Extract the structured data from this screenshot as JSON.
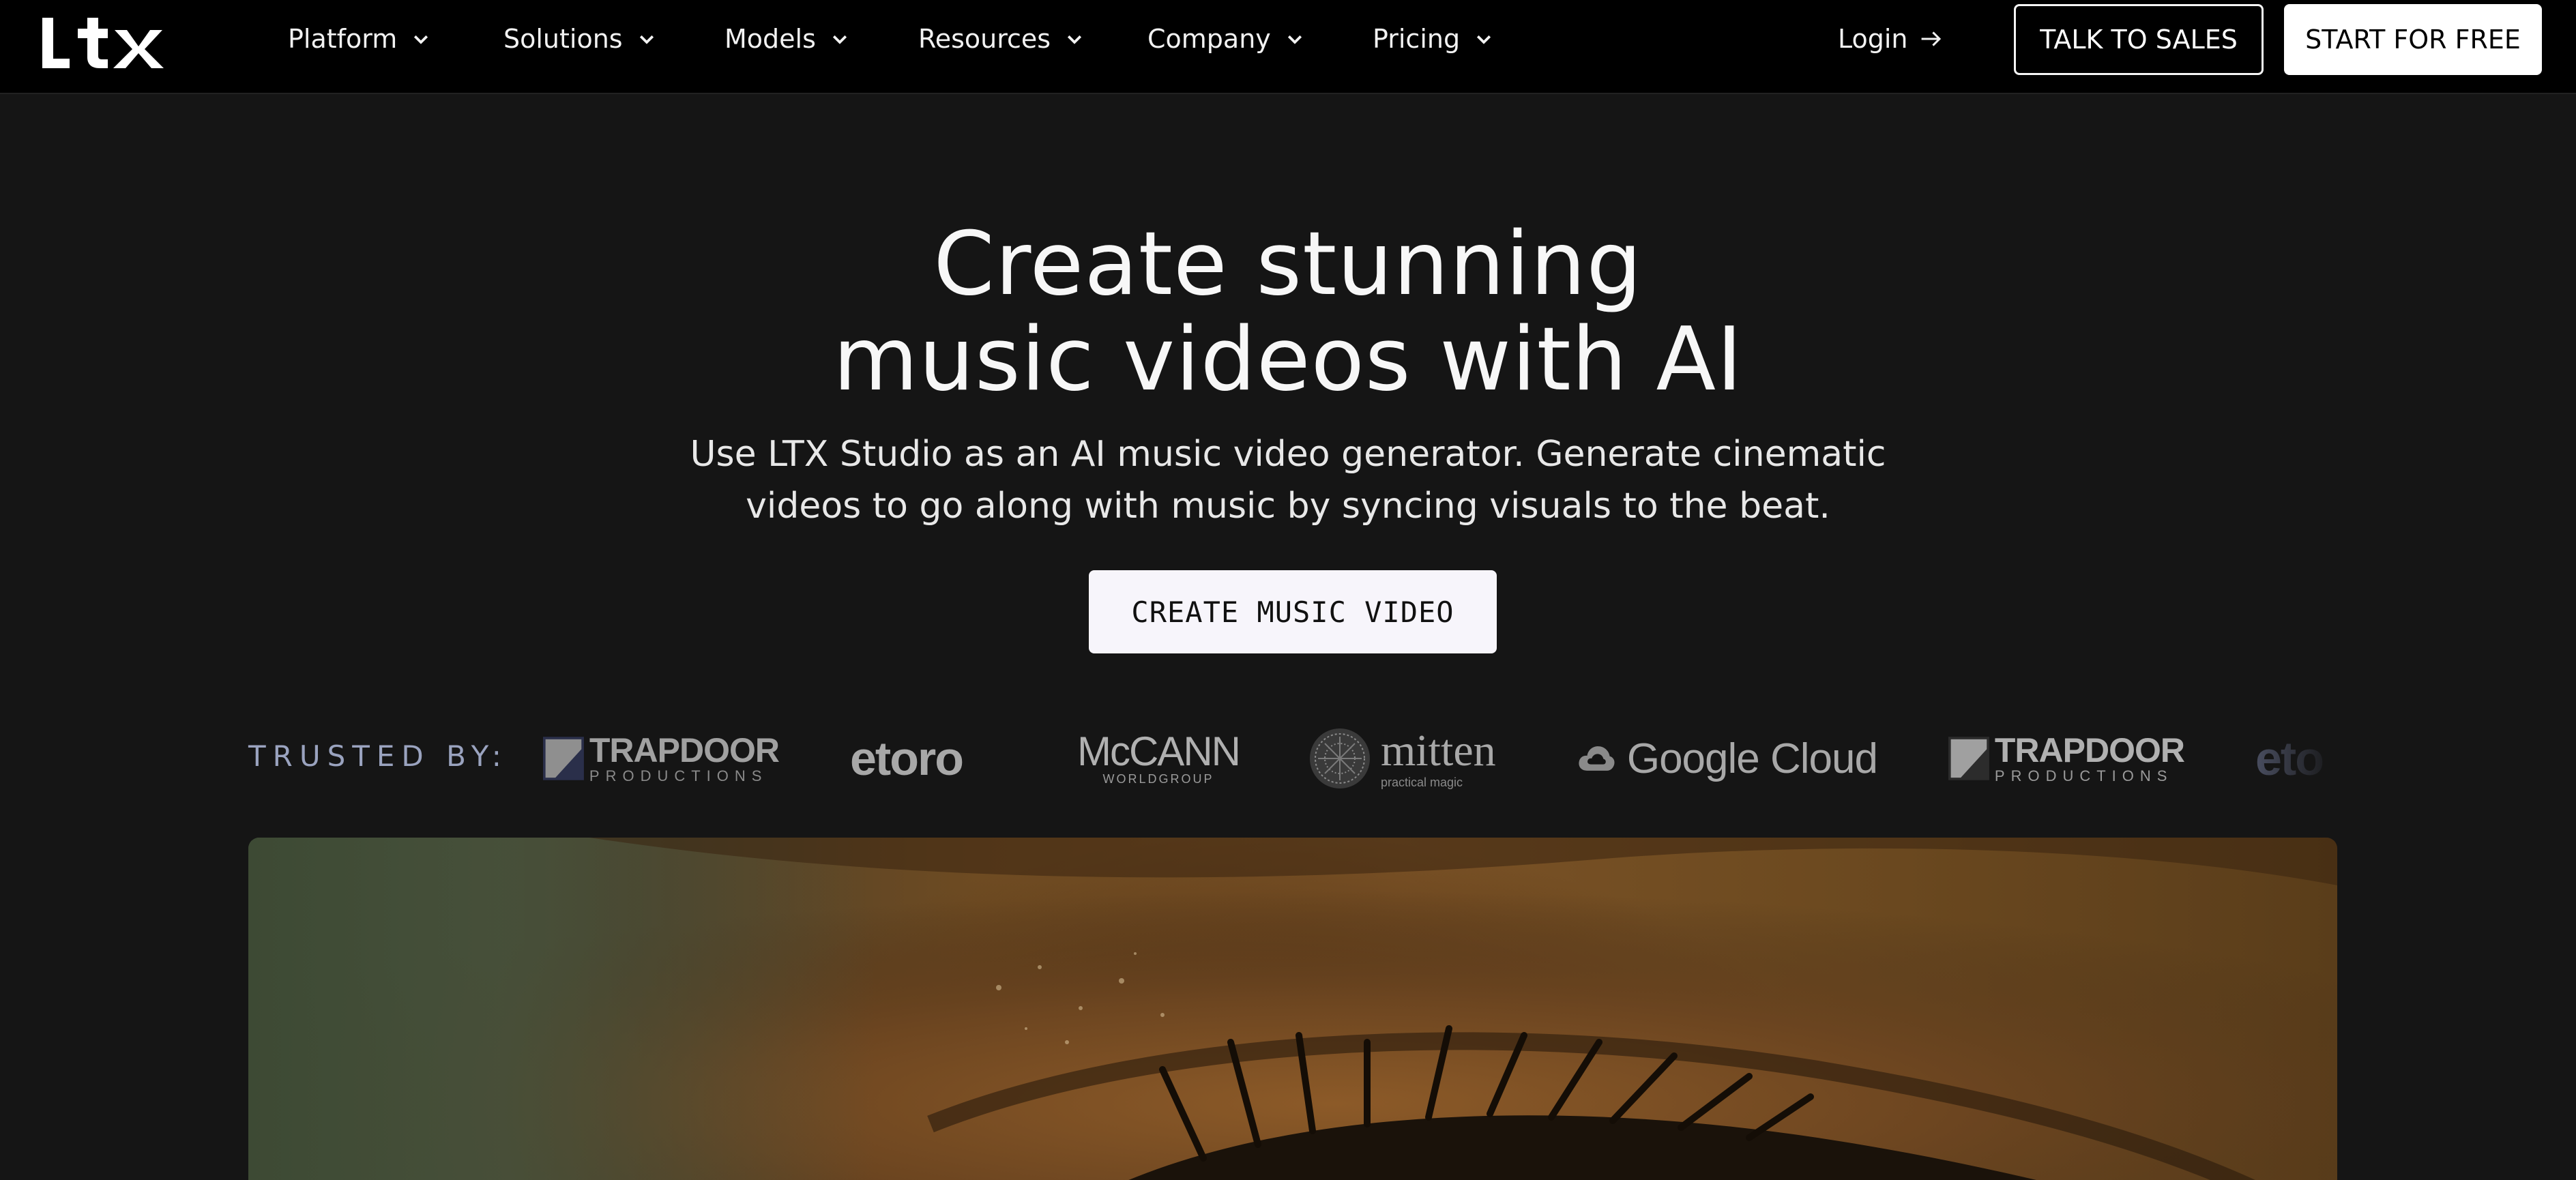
{
  "nav": {
    "logo": "LTX",
    "items": [
      {
        "label": "Platform"
      },
      {
        "label": "Solutions"
      },
      {
        "label": "Models"
      },
      {
        "label": "Resources"
      },
      {
        "label": "Company"
      },
      {
        "label": "Pricing"
      }
    ],
    "login": "Login",
    "talk_to_sales": "TALK TO SALES",
    "start_free": "START FOR FREE"
  },
  "hero": {
    "title_line1": "Create stunning",
    "title_line2": "music videos with AI",
    "subtitle_line1": "Use LTX Studio as an AI music video generator. Generate cinematic",
    "subtitle_line2": "videos to go along with music by syncing visuals to the beat.",
    "cta": "CREATE MUSIC VIDEO"
  },
  "trusted": {
    "label": "TRUSTED BY:",
    "logos": {
      "trapdoor_main": "TRAPDOOR",
      "trapdoor_sub": "PRODUCTIONS",
      "etoro": "etoro",
      "mccann_main": "McCANN",
      "mccann_sub": "WORLDGROUP",
      "mitten_main": "mitten",
      "mitten_sub": "practical magic",
      "google_cloud": "Google Cloud",
      "trapdoor2_main": "TRAPDOOR",
      "trapdoor2_sub": "PRODUCTIONS",
      "etoro2": "eto"
    }
  },
  "colors": {
    "nav_bg": "#000000",
    "page_bg": "#151515",
    "trusted_label": "#9aa3bf",
    "cta_bg": "#f7f5fb"
  }
}
